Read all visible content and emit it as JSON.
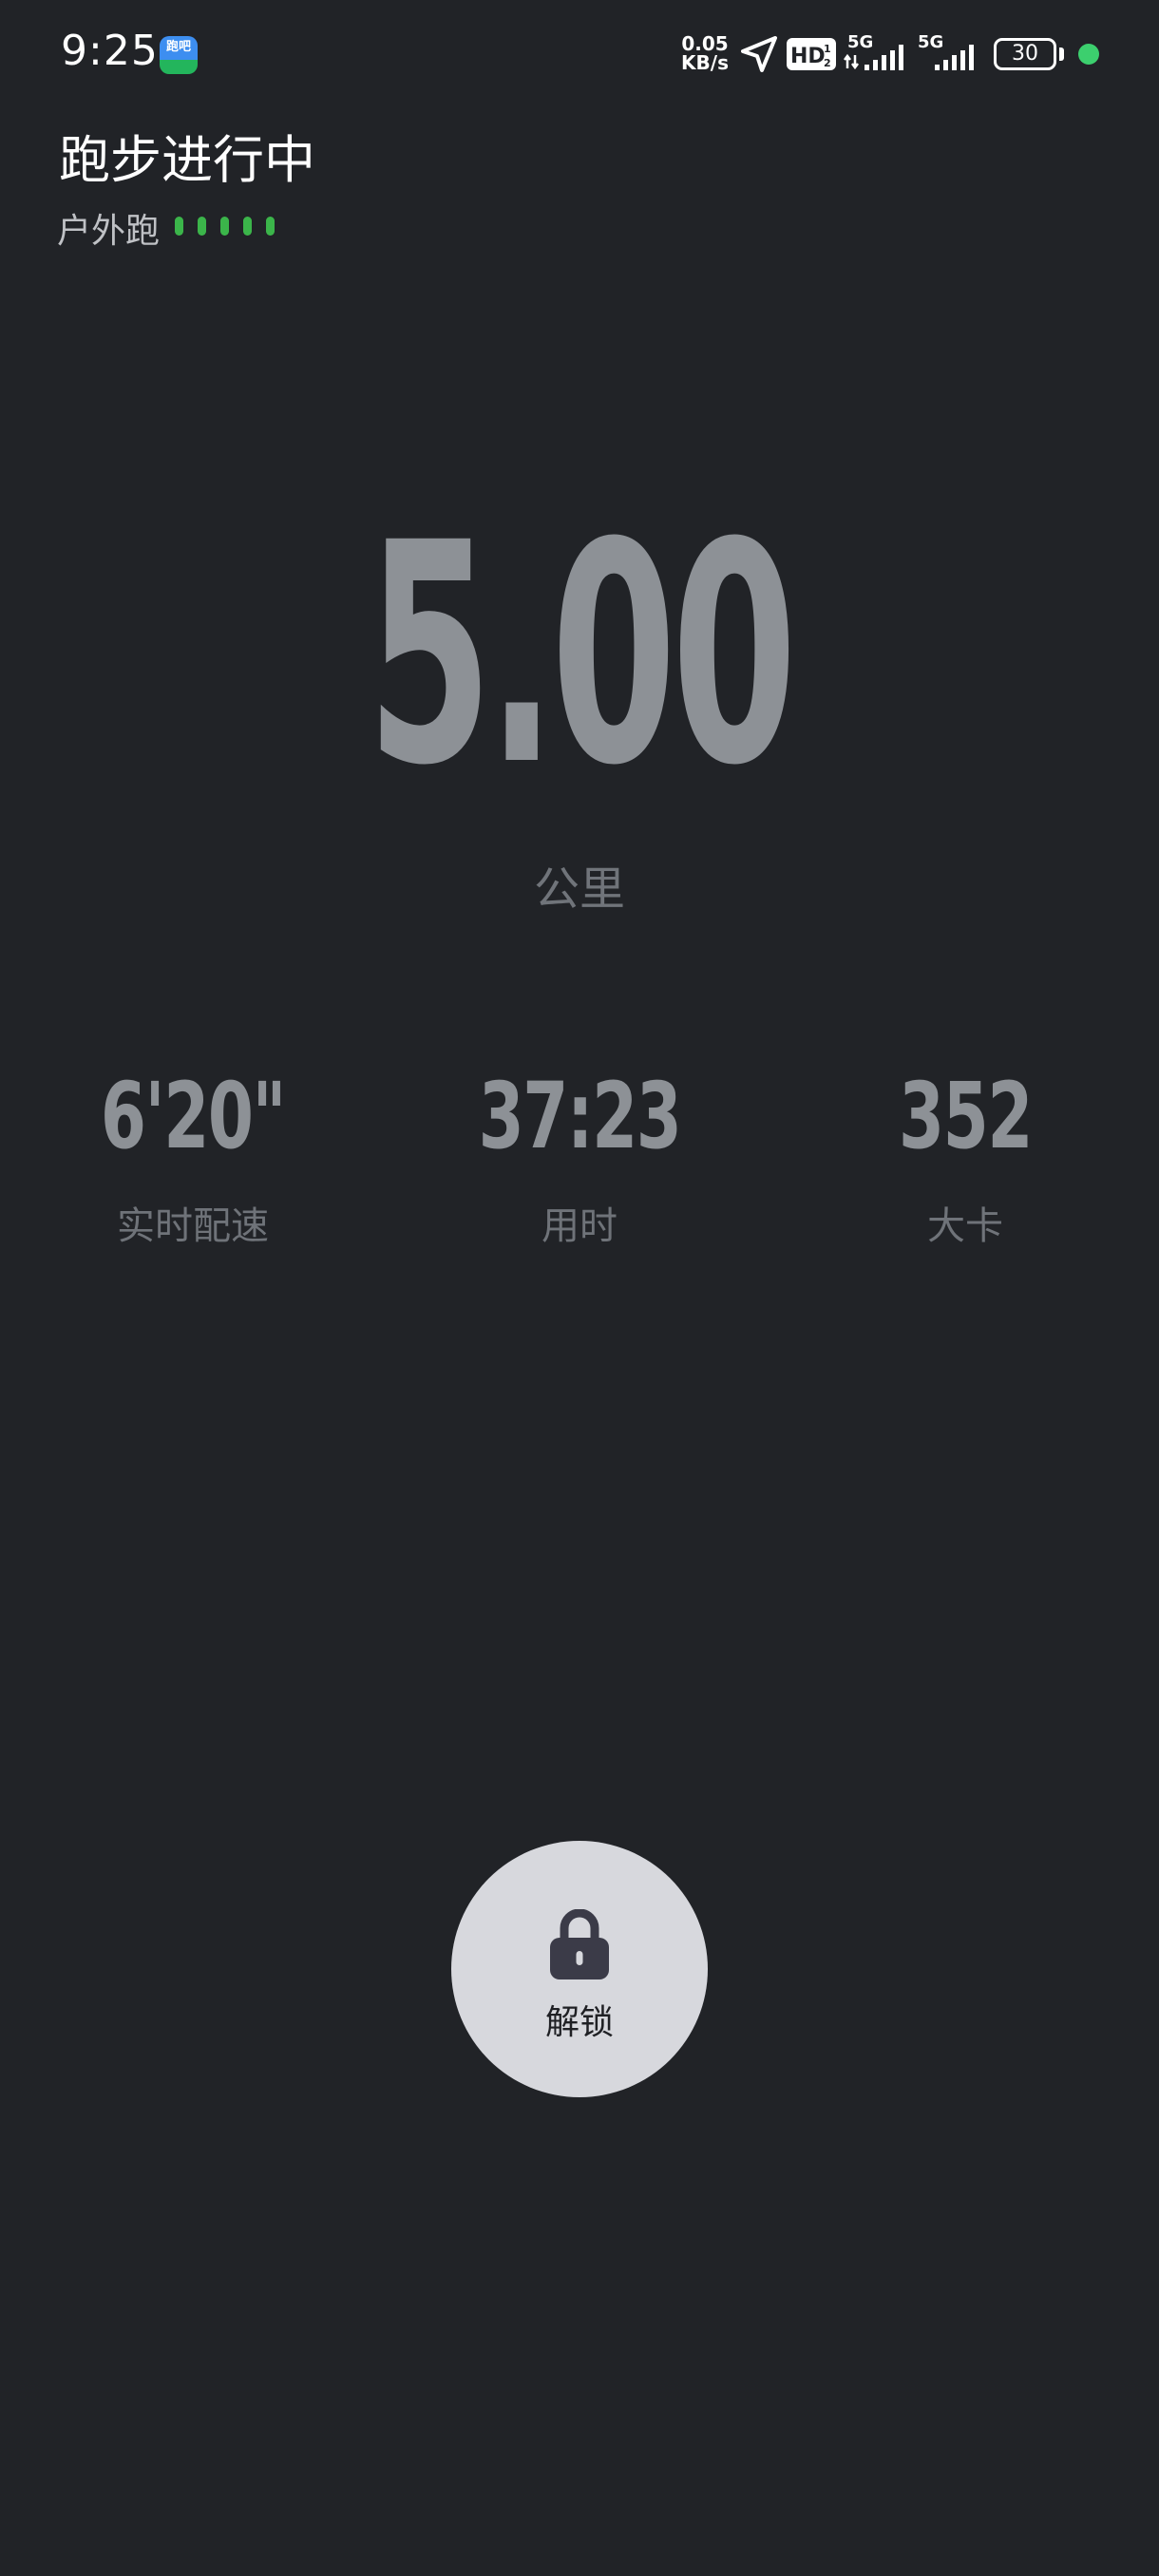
{
  "status_bar": {
    "time": "9:25",
    "app_icon_label": "跑吧",
    "net_speed_value": "0.05",
    "net_speed_unit": "KB/s",
    "hd_label": "HD",
    "network_label_1": "5G",
    "network_label_2": "5G",
    "battery_level": "30",
    "battery_fraction": 0.3,
    "indicator_color": "#3ccf6e"
  },
  "header": {
    "title": "跑步进行中",
    "mode": "户外跑",
    "gps_signal_bars": 5,
    "gps_signal_color": "#3bb54a"
  },
  "distance": {
    "value": "5.00",
    "unit": "公里"
  },
  "stats": [
    {
      "value": "6'20\"",
      "label": "实时配速"
    },
    {
      "value": "37:23",
      "label": "用时"
    },
    {
      "value": "352",
      "label": "大卡"
    }
  ],
  "unlock": {
    "label": "解锁"
  },
  "colors": {
    "background": "#212327",
    "value_gray": "#8d9196",
    "button_bg": "#d7d8dd",
    "lock_color": "#3b3b48"
  }
}
